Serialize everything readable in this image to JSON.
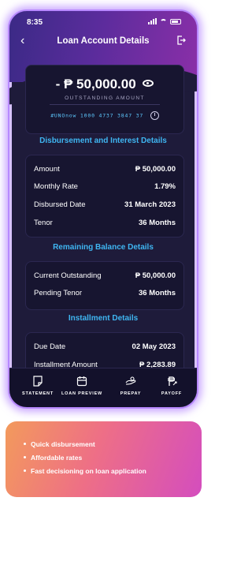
{
  "status_bar": {
    "time": "8:35"
  },
  "header": {
    "title": "Loan Account Details"
  },
  "balance": {
    "amount": "- ₱ 50,000.00",
    "caption": "OUTSTANDING AMOUNT",
    "account_number": "#UNOnow 1000 4737 3847 37"
  },
  "disbursement": {
    "title": "Disbursement and Interest Details",
    "rows": [
      {
        "label": "Amount",
        "value": "₱ 50,000.00"
      },
      {
        "label": "Monthly Rate",
        "value": "1.79%"
      },
      {
        "label": "Disbursed Date",
        "value": "31 March 2023"
      },
      {
        "label": "Tenor",
        "value": "36 Months"
      }
    ]
  },
  "remaining": {
    "title": "Remaining Balance Details",
    "rows": [
      {
        "label": "Current Outstanding",
        "value": "₱ 50,000.00"
      },
      {
        "label": "Pending Tenor",
        "value": "36 Months"
      }
    ]
  },
  "installment": {
    "title": "Installment Details",
    "rows": [
      {
        "label": "Due Date",
        "value": "02 May 2023"
      },
      {
        "label": "Installment Amount",
        "value": "₱ 2,283.89"
      }
    ]
  },
  "bottom_nav": [
    {
      "label": "STATEMENT",
      "icon": "statement-icon"
    },
    {
      "label": "LOAN PREVIEW",
      "icon": "calendar-icon"
    },
    {
      "label": "PREPAY",
      "icon": "prepay-icon"
    },
    {
      "label": "PAYOFF",
      "icon": "peso-icon"
    }
  ],
  "promo": {
    "bullets": [
      "Quick disbursement",
      "Affordable rates",
      "Fast decisioning on loan application"
    ]
  },
  "colors": {
    "accent_blue": "#3fb6f2",
    "card_bg": "#171530",
    "phone_glow": "#b889ff"
  }
}
